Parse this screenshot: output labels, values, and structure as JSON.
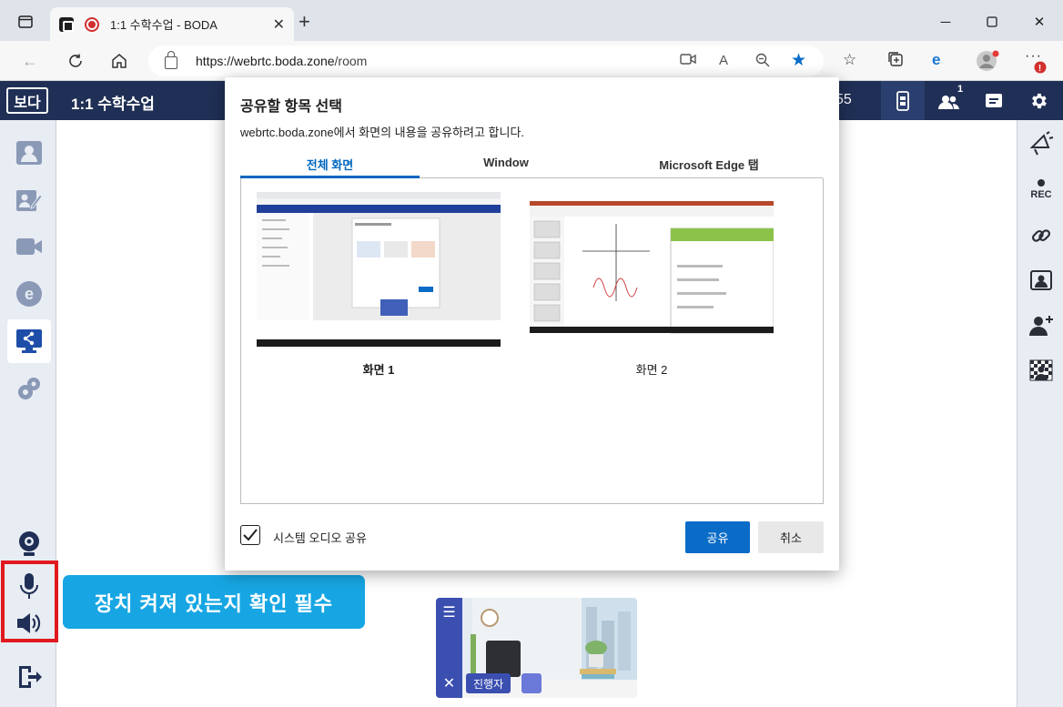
{
  "browser": {
    "tab_title": "1:1 수학수업 - BODA",
    "url_host": "https://webrtc.boda.zone",
    "url_path": "/room"
  },
  "app": {
    "logo": "보다",
    "title": "1:1 수학수업",
    "clock": "55",
    "participants_count": "1"
  },
  "dialog": {
    "title": "공유할 항목 선택",
    "subtitle": "webrtc.boda.zone에서 화면의 내용을 공유하려고 합니다.",
    "tabs": [
      "전체 화면",
      "Window",
      "Microsoft Edge 탭"
    ],
    "screens": [
      "화면 1",
      "화면 2"
    ],
    "audio_label": "시스템 오디오 공유",
    "audio_checked": true,
    "share_button": "공유",
    "cancel_button": "취소"
  },
  "right_sidebar": {
    "rec_label": "REC"
  },
  "tip": "장치 켜져 있는지 확인 필수",
  "video": {
    "name_badge": "진행자"
  },
  "colors": {
    "header": "#1f2f55",
    "accent": "#0a6cc7",
    "tip": "#17a6e3",
    "highlight": "#e0191e",
    "sidebar_icon": "#8a99b6",
    "active_icon": "#1e4ea8"
  }
}
